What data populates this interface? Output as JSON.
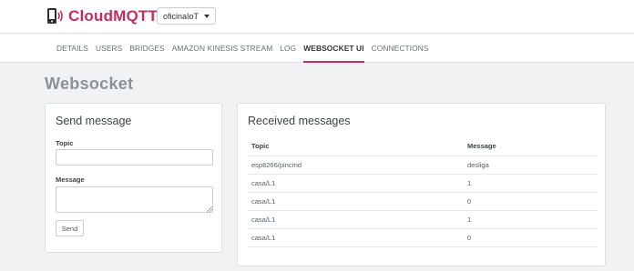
{
  "brand": {
    "name": "CloudMQTT"
  },
  "instance_select": {
    "value": "oficinaIoT"
  },
  "nav": {
    "items": [
      {
        "label": "Details",
        "active": false
      },
      {
        "label": "Users",
        "active": false
      },
      {
        "label": "Bridges",
        "active": false
      },
      {
        "label": "Amazon Kinesis Stream",
        "active": false
      },
      {
        "label": "Log",
        "active": false
      },
      {
        "label": "Websocket UI",
        "active": true
      },
      {
        "label": "Connections",
        "active": false
      }
    ]
  },
  "page": {
    "title": "Websocket"
  },
  "send_card": {
    "title": "Send message",
    "topic_label": "Topic",
    "topic_value": "",
    "message_label": "Message",
    "message_value": "",
    "send_label": "Send"
  },
  "received_card": {
    "title": "Received messages",
    "columns": [
      "Topic",
      "Message"
    ],
    "rows": [
      {
        "topic": "esp8266/pincmd",
        "message": "desliga"
      },
      {
        "topic": "casa/L1",
        "message": "1"
      },
      {
        "topic": "casa/L1",
        "message": "0"
      },
      {
        "topic": "casa/L1",
        "message": "1"
      },
      {
        "topic": "casa/L1",
        "message": "0"
      }
    ]
  },
  "colors": {
    "accent": "#c22f5e",
    "background": "#f1f2f4"
  }
}
